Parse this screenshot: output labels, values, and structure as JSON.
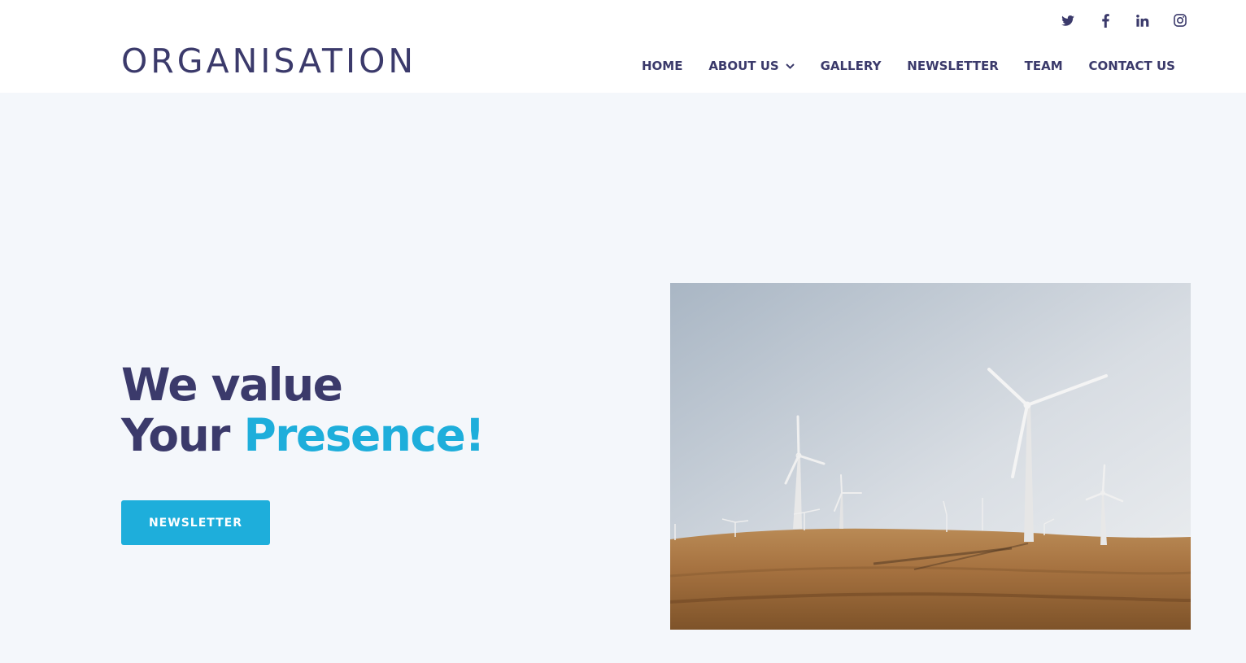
{
  "header": {
    "logo": "ORGANISATION",
    "social": [
      {
        "icon": "twitter-icon"
      },
      {
        "icon": "facebook-icon"
      },
      {
        "icon": "linkedin-icon"
      },
      {
        "icon": "instagram-icon"
      }
    ],
    "nav": {
      "home": "HOME",
      "about": "ABOUT US",
      "gallery": "GALLERY",
      "newsletter": "NEWSLETTER",
      "team": "TEAM",
      "contact": "CONTACT US"
    }
  },
  "hero": {
    "line1": "We value",
    "line2_plain": "Your",
    "line2_accent": "Presence!",
    "cta_label": "NEWSLETTER",
    "image": "wind-turbines-field-image"
  },
  "colors": {
    "primary_text": "#3b3a6b",
    "accent": "#1eaedb",
    "page_bg": "#f4f7fb",
    "header_bg": "#ffffff"
  }
}
